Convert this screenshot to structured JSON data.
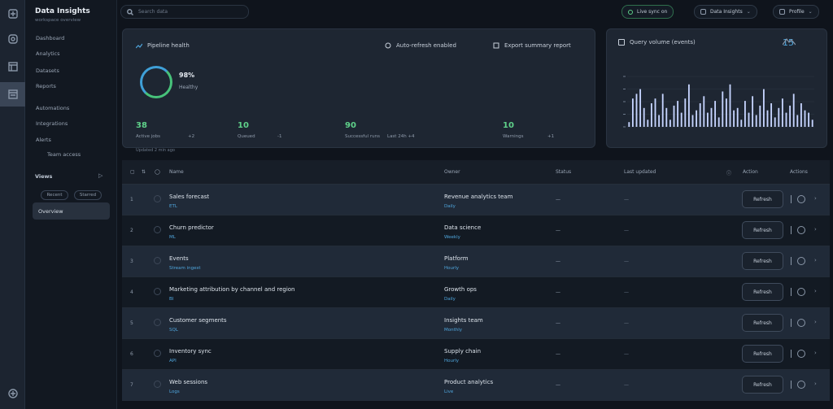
{
  "sidebar": {
    "brand": "Data Insights",
    "brand_sub": "workspace overview",
    "items": [
      "Dashboard",
      "Analytics",
      "Datasets",
      "Reports",
      "Automations",
      "Integrations",
      "Alerts",
      "Team access"
    ],
    "section": "Views",
    "chips": [
      "Recent",
      "Starred"
    ],
    "active": "Overview"
  },
  "topbar": {
    "search_placeholder": "Search data",
    "status": "Live sync on",
    "workspace": "Data Insights",
    "profile": "Profile"
  },
  "summary_card": {
    "title": "Pipeline health",
    "filter_label": "Auto-refresh enabled",
    "export_label": "Export summary report",
    "ring_value": "98%",
    "ring_label": "Healthy",
    "stats": [
      {
        "value": "38",
        "label": "Active jobs",
        "extra": "+2"
      },
      {
        "value": "10",
        "label": "Queued",
        "extra": "-1"
      },
      {
        "value": "90",
        "label": "Successful runs",
        "extra": "Last 24h +4"
      },
      {
        "value": "10",
        "label": "Warnings",
        "extra": "+1"
      }
    ],
    "foot": "Updated 2 min ago"
  },
  "chart_card": {
    "title": "Query volume (events)",
    "corner": "15"
  },
  "chart_data": {
    "type": "bar",
    "values": [
      2,
      12,
      14,
      16,
      8,
      3,
      10,
      12,
      5,
      14,
      8,
      3,
      9,
      11,
      6,
      12,
      18,
      5,
      7,
      10,
      13,
      6,
      8,
      11,
      4,
      15,
      12,
      18,
      7,
      8,
      3,
      11,
      6,
      13,
      5,
      9,
      16,
      7,
      10,
      4,
      8,
      12,
      6,
      9,
      14,
      5,
      10,
      7,
      6,
      3
    ],
    "ylim": [
      0,
      20
    ],
    "grid": true
  },
  "table": {
    "headers": [
      "Name",
      "Owner",
      "Status",
      "Last updated",
      "Action",
      "Actions"
    ],
    "rows": [
      {
        "idx": "1",
        "name": "Sales forecast",
        "sub": "ETL",
        "owner": "Revenue analytics team",
        "owner_sub": "Daily",
        "status": "—",
        "updated": "—",
        "action": "Refresh"
      },
      {
        "idx": "2",
        "name": "Churn predictor",
        "sub": "ML",
        "owner": "Data science",
        "owner_sub": "Weekly",
        "status": "—",
        "updated": "—",
        "action": "Refresh"
      },
      {
        "idx": "3",
        "name": "Events",
        "sub": "Stream ingest",
        "owner": "Platform",
        "owner_sub": "Hourly",
        "status": "—",
        "updated": "—",
        "action": "Refresh"
      },
      {
        "idx": "4",
        "name": "Marketing attribution by channel and region",
        "sub": "BI",
        "owner": "Growth ops",
        "owner_sub": "Daily",
        "status": "—",
        "updated": "—",
        "action": "Refresh"
      },
      {
        "idx": "5",
        "name": "Customer segments",
        "sub": "SQL",
        "owner": "Insights team",
        "owner_sub": "Monthly",
        "status": "—",
        "updated": "—",
        "action": "Refresh"
      },
      {
        "idx": "6",
        "name": "Inventory sync",
        "sub": "API",
        "owner": "Supply chain",
        "owner_sub": "Hourly",
        "status": "—",
        "updated": "—",
        "action": "Refresh"
      },
      {
        "idx": "7",
        "name": "Web sessions",
        "sub": "Logs",
        "owner": "Product analytics",
        "owner_sub": "Live",
        "status": "—",
        "updated": "—",
        "action": "Refresh"
      }
    ]
  },
  "colors": {
    "accent_green": "#5fd18a",
    "accent_blue": "#4fa6dd",
    "bar": "#c6d4ff"
  }
}
